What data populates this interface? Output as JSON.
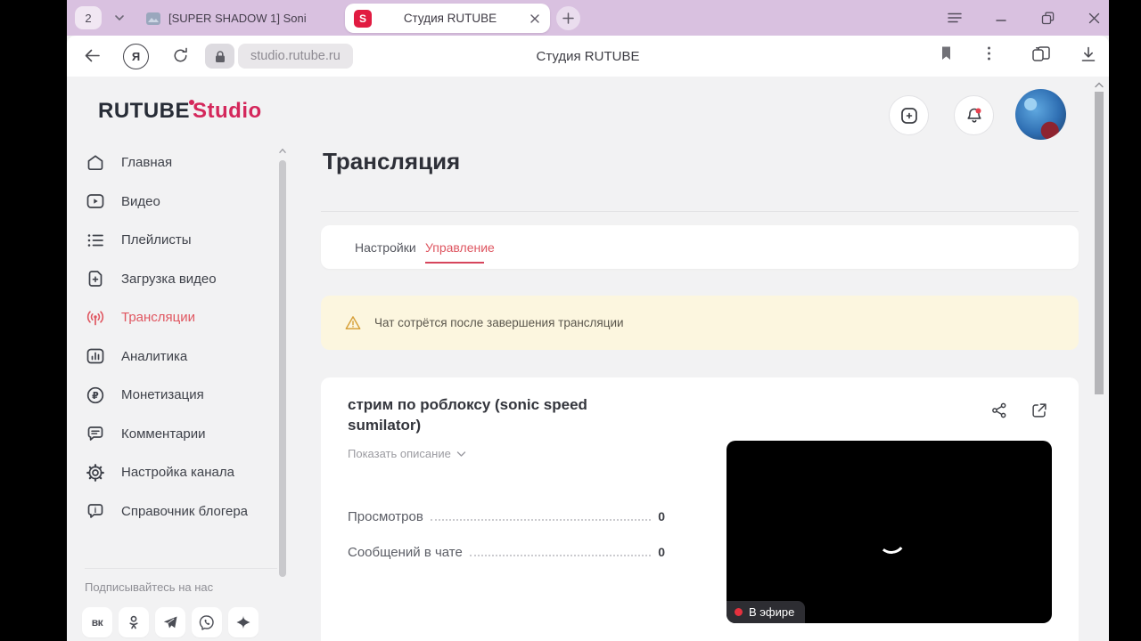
{
  "browser": {
    "tab_count": "2",
    "inactive_tab_title": "[SUPER SHADOW 1] Soni",
    "active_tab_title": "Студия RUTUBE",
    "favicon_glyph": "S",
    "yandex_glyph": "Я",
    "url": "studio.rutube.ru",
    "page_title": "Студия RUTUBE"
  },
  "studio_header": {
    "logo_primary": "RUTUBE",
    "logo_secondary": "Studio"
  },
  "sidebar": {
    "items": [
      {
        "label": "Главная"
      },
      {
        "label": "Видео"
      },
      {
        "label": "Плейлисты"
      },
      {
        "label": "Загрузка видео"
      },
      {
        "label": "Трансляции",
        "active": true
      },
      {
        "label": "Аналитика"
      },
      {
        "label": "Монетизация"
      },
      {
        "label": "Комментарии"
      },
      {
        "label": "Настройка канала"
      },
      {
        "label": "Справочник блогера"
      }
    ],
    "ruble_glyph": "₽",
    "info_glyph": "i",
    "follow_label": "Подписывайтесь на нас",
    "vk_glyph": "вк"
  },
  "main": {
    "page_title": "Трансляция",
    "tabs": [
      {
        "label": "Настройки"
      },
      {
        "label": "Управление",
        "active": true
      }
    ],
    "warning_text": "Чат сотрётся после завершения трансляции",
    "stream": {
      "title": "стрим по роблоксу (sonic speed sumilator)",
      "show_description_label": "Показать описание",
      "stats": [
        {
          "label": "Просмотров",
          "value": "0"
        },
        {
          "label": "Сообщений в чате",
          "value": "0"
        }
      ],
      "live_badge": "В эфире"
    }
  },
  "colors": {
    "accent_red": "#e11b41",
    "studio_pink": "#d4275b",
    "active_item_red": "#e05660",
    "tabbar_bg": "#d9c1e0",
    "warning_bg": "#fcf6df"
  }
}
